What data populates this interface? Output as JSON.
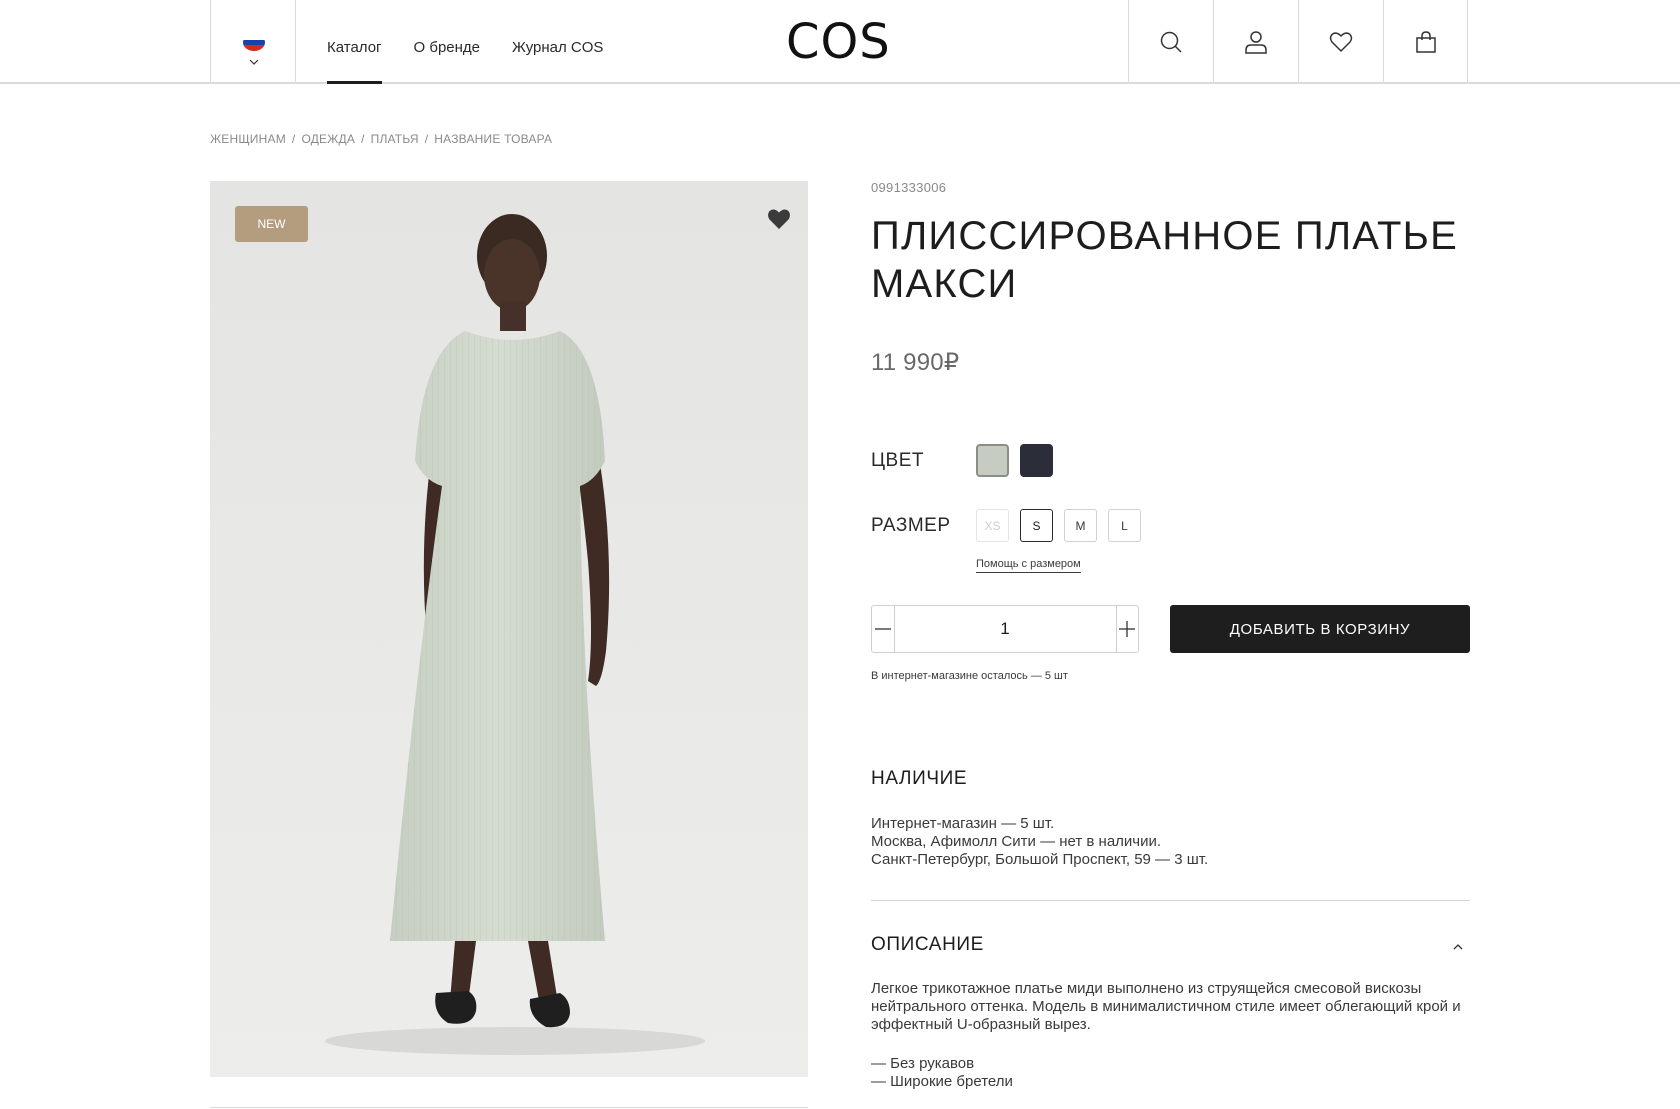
{
  "header": {
    "nav": [
      {
        "label": "Каталог",
        "active": true
      },
      {
        "label": "О бренде",
        "active": false
      },
      {
        "label": "Журнал COS",
        "active": false
      }
    ],
    "logo": "COS",
    "icons": [
      "search-icon",
      "user-icon",
      "heart-icon",
      "bag-icon"
    ]
  },
  "breadcrumb": [
    "ЖЕНЩИНАМ",
    "ОДЕЖДА",
    "ПЛАТЬЯ",
    "НАЗВАНИЕ ТОВАРА"
  ],
  "product": {
    "badge": "NEW",
    "sku": "0991333006",
    "title": "ПЛИССИРОВАННОЕ ПЛАТЬЕ МАКСИ",
    "price": "11 990₽",
    "color_label": "ЦВЕТ",
    "colors": [
      "#c7ccc2",
      "#2b2d38"
    ],
    "size_label": "РАЗМЕР",
    "sizes": [
      {
        "label": "XS",
        "available": false,
        "selected": false
      },
      {
        "label": "S",
        "available": true,
        "selected": true
      },
      {
        "label": "M",
        "available": true,
        "selected": false
      },
      {
        "label": "L",
        "available": true,
        "selected": false
      }
    ],
    "size_help": "Помощь с размером",
    "quantity": "1",
    "add_to_cart": "ДОБАВИТЬ В КОРЗИНУ",
    "stock_note": "В интернет-магазине осталось — 5 шт"
  },
  "availability": {
    "title": "НАЛИЧИЕ",
    "lines": [
      "Интернет-магазин — 5 шт.",
      "Москва, Афимолл Сити — нет в наличии.",
      "Санкт-Петербург, Большой Проспект, 59 — 3 шт."
    ]
  },
  "description": {
    "title": "ОПИСАНИЕ",
    "text": "Легкое трикотажное платье миди выполнено из струящейся смесовой вискозы нейтрального оттенка. Модель в минималистичном стиле имеет облегающий крой и эффектный U-образный вырез.",
    "bullets": [
      "— Без рукавов",
      "— Широкие бретели"
    ]
  }
}
